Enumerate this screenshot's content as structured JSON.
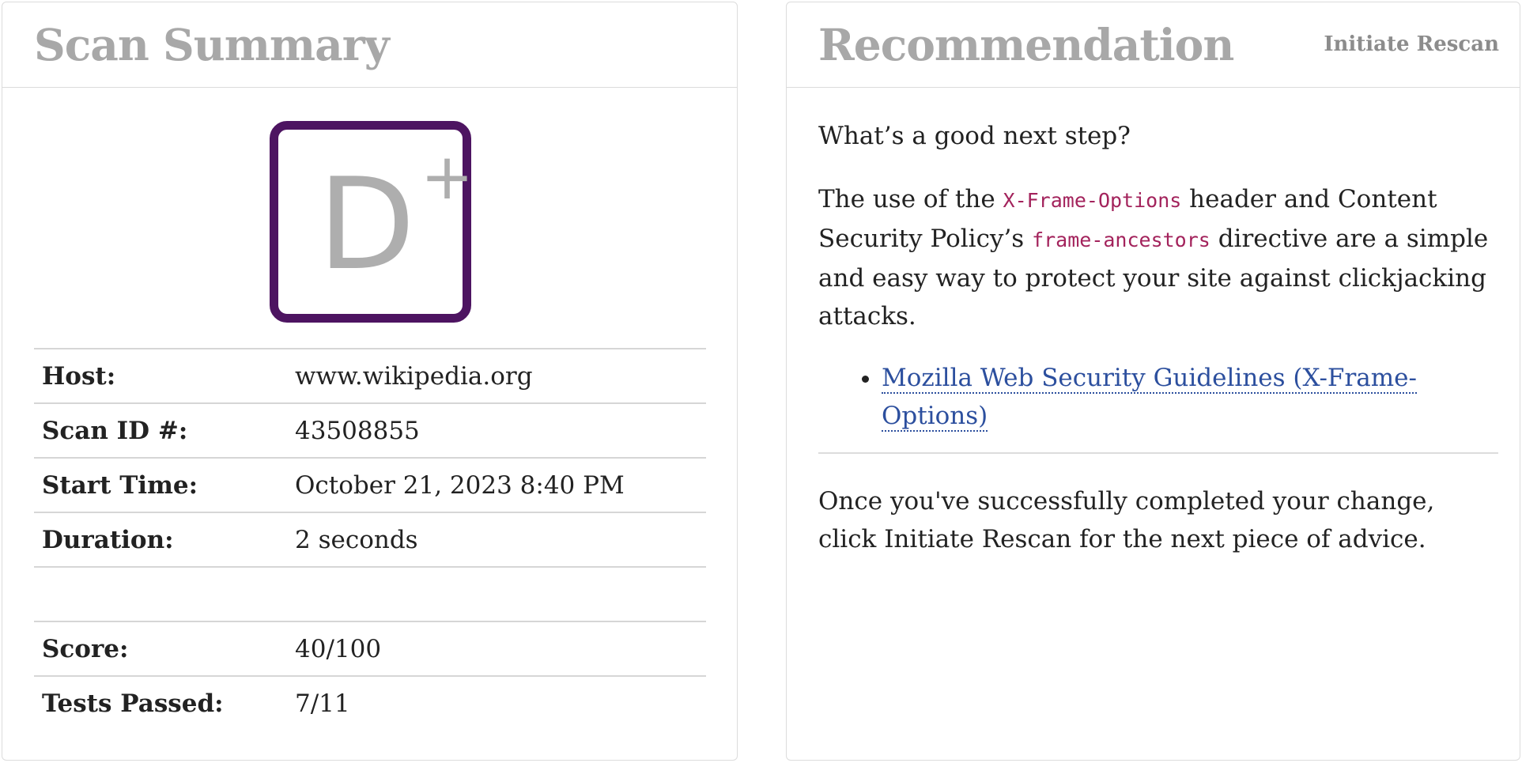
{
  "summary": {
    "title": "Scan Summary",
    "grade": {
      "letter": "D",
      "modifier": "+",
      "border_color": "#4d1461"
    },
    "rows": [
      {
        "label": "Host:",
        "value": "www.wikipedia.org"
      },
      {
        "label": "Scan ID #:",
        "value": "43508855"
      },
      {
        "label": "Start Time:",
        "value": "October 21, 2023 8:40 PM"
      },
      {
        "label": "Duration:",
        "value": "2 seconds"
      },
      {
        "label": "Score:",
        "value": "40/100"
      },
      {
        "label": "Tests Passed:",
        "value": "7/11"
      }
    ]
  },
  "recommendation": {
    "title": "Recommendation",
    "rescan_label": "Initiate Rescan",
    "question": "What’s a good next step?",
    "body_part1": "The use of the ",
    "code1": "X-Frame-Options",
    "body_part2": " header and Content Security Policy’s ",
    "code2": "frame-ancestors",
    "body_part3": " directive are a simple and easy way to protect your site against clickjacking attacks.",
    "links": [
      {
        "label": "Mozilla Web Security Guidelines (X-Frame-Options)"
      }
    ],
    "closing": "Once you've successfully completed your change, click Initiate Rescan for the next piece of advice."
  },
  "colors": {
    "code_text": "#a3235c",
    "link": "#2c4f9e",
    "title_gray": "#a8a8a8"
  }
}
